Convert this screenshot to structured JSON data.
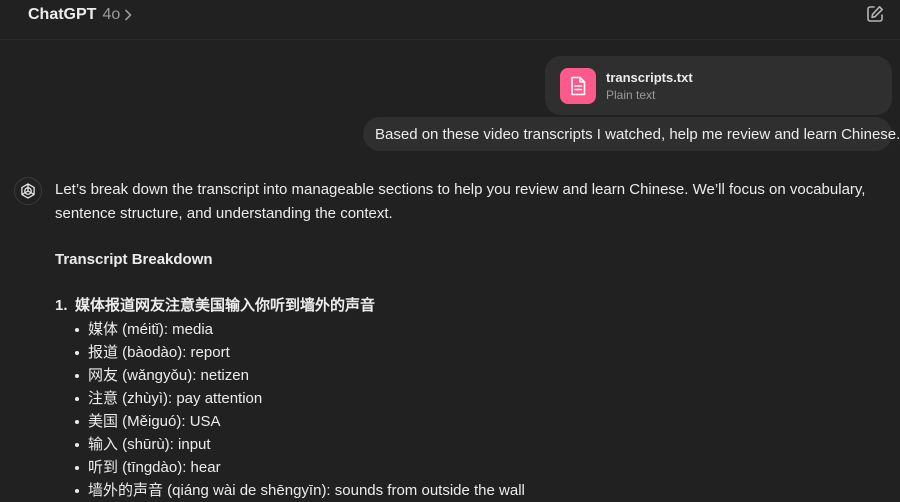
{
  "header": {
    "app_title": "ChatGPT",
    "model": "4o",
    "icons": {
      "model_chevron": "chevron-right-icon",
      "new_chat": "new-chat-icon"
    }
  },
  "attachment": {
    "file_name": "transcripts.txt",
    "file_type": "Plain text",
    "icon": "document-icon",
    "icon_color": "#fb5a8a"
  },
  "user_message": "Based on these video transcripts I watched, help me review and learn Chinese.",
  "assistant": {
    "avatar_icon": "openai-logo-icon",
    "intro": "Let’s break down the transcript into manageable sections to help you review and learn Chinese. We’ll focus on vocabulary, sentence structure, and understanding the context.",
    "heading": "Transcript Breakdown",
    "items": [
      {
        "number": "1.",
        "title": "媒体报道网友注意美国输入你听到墙外的声音",
        "vocab": [
          "媒体 (méitǐ): media",
          "报道 (bàodào): report",
          "网友 (wǎngyǒu): netizen",
          "注意 (zhùyì): pay attention",
          "美国 (Měiguó): USA",
          "输入 (shūrù): input",
          "听到 (tīngdào): hear",
          "墙外的声音 (qiáng wài de shēngyīn): sounds from outside the wall"
        ]
      }
    ]
  },
  "colors": {
    "background": "#212121",
    "bubble": "#2f2f2f",
    "text": "#ececec",
    "muted": "#9b9b9b"
  }
}
